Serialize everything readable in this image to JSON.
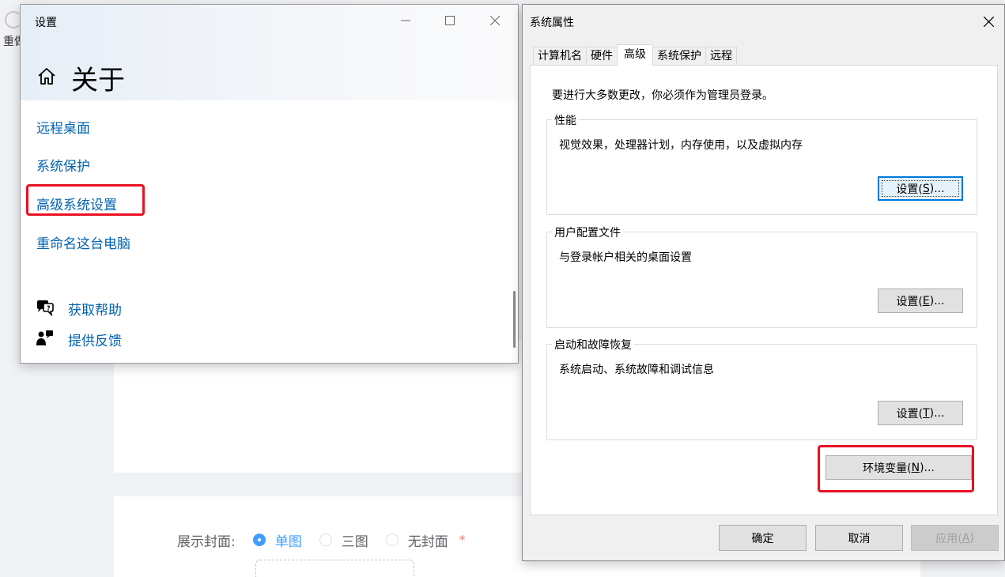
{
  "background": {
    "edge_text": "重做",
    "cover": {
      "label": "展示封面:",
      "options": [
        {
          "label": "单图",
          "checked": true
        },
        {
          "label": "三图",
          "checked": false
        },
        {
          "label": "无封面",
          "checked": false
        }
      ],
      "required_mark": "*"
    }
  },
  "settings": {
    "window_title": "设置",
    "page_title": "关于",
    "links": [
      "远程桌面",
      "系统保护",
      "高级系统设置",
      "重命名这台电脑"
    ],
    "highlighted_link": "高级系统设置",
    "help": {
      "get_help": "获取帮助",
      "feedback": "提供反馈"
    }
  },
  "system_properties": {
    "title": "系统属性",
    "tabs": [
      "计算机名",
      "硬件",
      "高级",
      "系统保护",
      "远程"
    ],
    "active_tab": "高级",
    "admin_note": "要进行大多数更改，你必须作为管理员登录。",
    "performance": {
      "legend": "性能",
      "description": "视觉效果，处理器计划，内存使用，以及虚拟内存",
      "button": {
        "text": "设置(",
        "key": "S",
        "suffix": ")..."
      }
    },
    "user_profiles": {
      "legend": "用户配置文件",
      "description": "与登录帐户相关的桌面设置",
      "button": {
        "text": "设置(",
        "key": "E",
        "suffix": ")..."
      }
    },
    "startup_recovery": {
      "legend": "启动和故障恢复",
      "description": "系统启动、系统故障和调试信息",
      "button": {
        "text": "设置(",
        "key": "T",
        "suffix": ")..."
      }
    },
    "env_button": {
      "text": "环境变量(",
      "key": "N",
      "suffix": ")..."
    },
    "footer": {
      "ok": "确定",
      "cancel": "取消",
      "apply": {
        "text": "应用(",
        "key": "A",
        "suffix": ")"
      }
    }
  },
  "colors": {
    "link": "#0063b1",
    "highlight_box": "#e81123",
    "radio_checked": "#409eff",
    "default_button_border": "#0078d7"
  }
}
